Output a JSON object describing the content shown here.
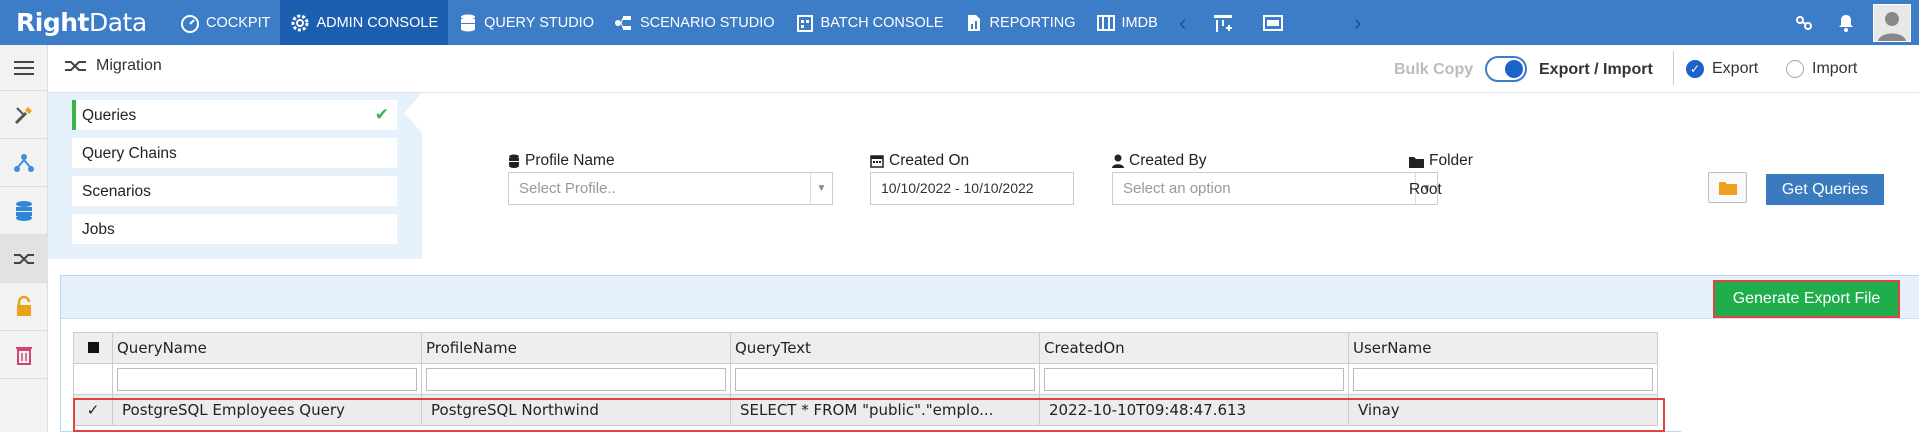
{
  "brand": {
    "logo_text_bold": "Right",
    "logo_text": "Data"
  },
  "nav": {
    "items": [
      {
        "label": "COCKPIT",
        "icon": "gauge-icon"
      },
      {
        "label": "ADMIN CONSOLE",
        "icon": "gear-icon",
        "active": true
      },
      {
        "label": "QUERY STUDIO",
        "icon": "database-icon"
      },
      {
        "label": "SCENARIO STUDIO",
        "icon": "scenario-icon"
      },
      {
        "label": "BATCH CONSOLE",
        "icon": "batch-icon"
      },
      {
        "label": "REPORTING",
        "icon": "report-icon"
      },
      {
        "label": "IMDB",
        "icon": "imdb-icon"
      }
    ],
    "accent": "#3d7dc7",
    "active_bg": "#1c5fb0"
  },
  "header": {
    "title": "Migration",
    "bulk_copy": "Bulk Copy",
    "export_import": "Export / Import",
    "export": "Export",
    "import": "Import"
  },
  "categories": [
    {
      "label": "Queries",
      "active": true
    },
    {
      "label": "Query Chains"
    },
    {
      "label": "Scenarios"
    },
    {
      "label": "Jobs"
    }
  ],
  "filters": {
    "profile_label": "Profile Name",
    "profile_placeholder": "Select Profile..",
    "created_on_label": "Created On",
    "created_on_value": "10/10/2022 - 10/10/2022",
    "created_by_label": "Created By",
    "created_by_placeholder": "Select an option",
    "folder_label": "Folder",
    "folder_value": "Root",
    "get_queries": "Get Queries"
  },
  "grid": {
    "generate_button": "Generate Export File",
    "columns": [
      "QueryName",
      "ProfileName",
      "QueryText",
      "CreatedOn",
      "UserName"
    ],
    "rows": [
      {
        "checked": "✓",
        "QueryName": "PostgreSQL Employees Query",
        "ProfileName": "PostgreSQL Northwind",
        "QueryText": "SELECT * FROM \"public\".\"emplo...",
        "CreatedOn": "2022-10-10T09:48:47.613",
        "UserName": "Vinay"
      }
    ]
  }
}
